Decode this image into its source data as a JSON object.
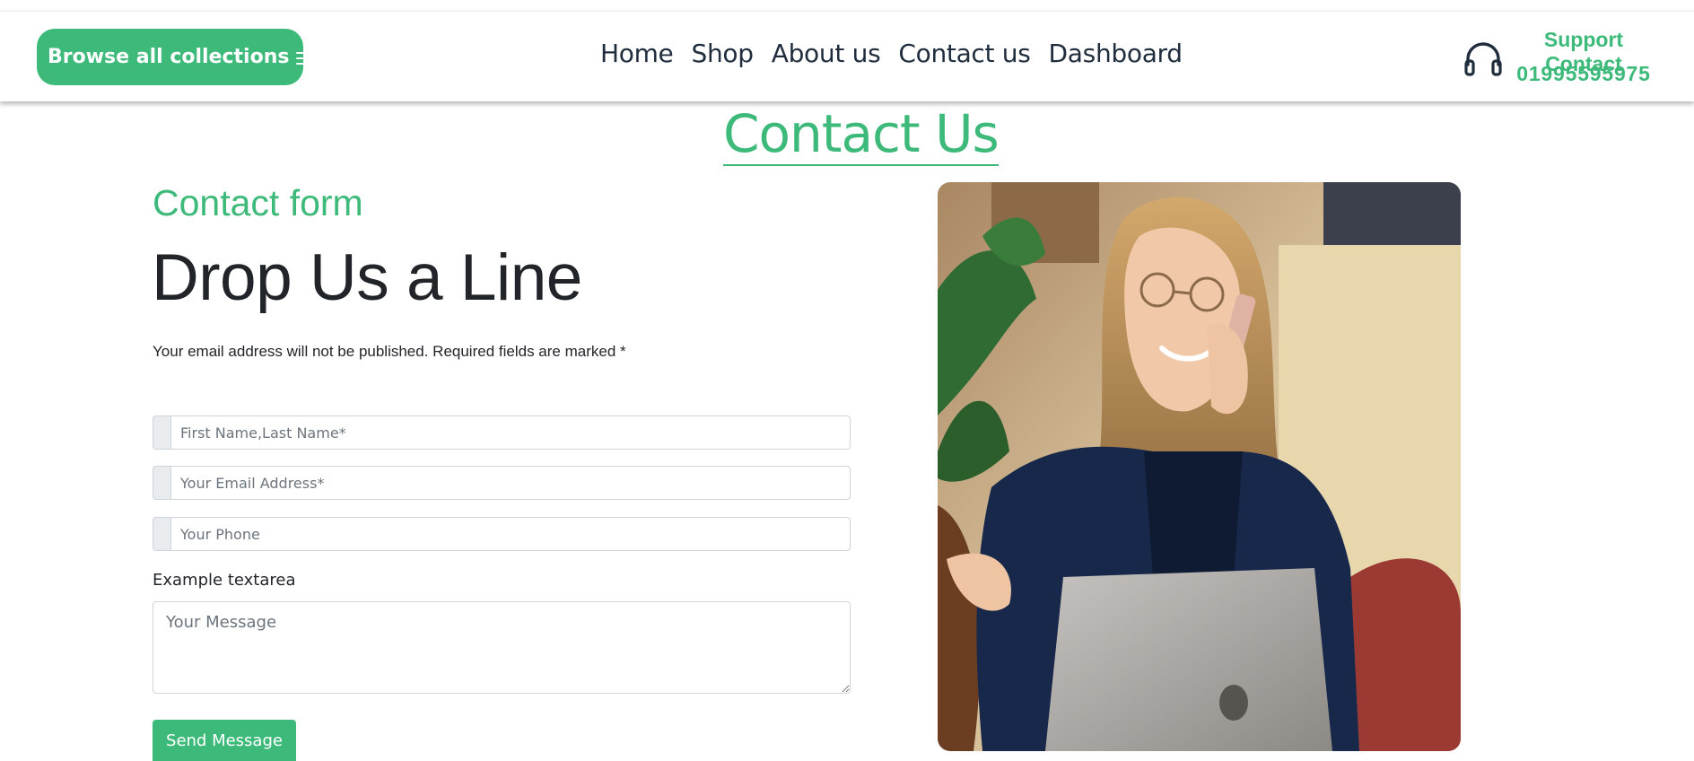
{
  "header": {
    "browse_label": "Browse all collections",
    "nav": [
      "Home",
      "Shop",
      "About us",
      "Contact us",
      "Dashboard"
    ],
    "support_title": "Support Contact",
    "support_phone": "01995595975"
  },
  "page": {
    "title": "Contact Us"
  },
  "form": {
    "eyebrow": "Contact form",
    "heading": "Drop Us a Line",
    "note": "Your email address will not be published. Required fields are marked *",
    "name_placeholder": "First Name,Last Name*",
    "email_placeholder": "Your Email Address*",
    "phone_placeholder": "Your Phone",
    "textarea_label": "Example textarea",
    "message_placeholder": "Your Message",
    "submit_label": "Send Message"
  },
  "colors": {
    "accent": "#3dba7a",
    "nav_text": "#1f2d3d"
  },
  "icons": {
    "menu": "hamburger-icon",
    "support": "headphones-icon"
  }
}
